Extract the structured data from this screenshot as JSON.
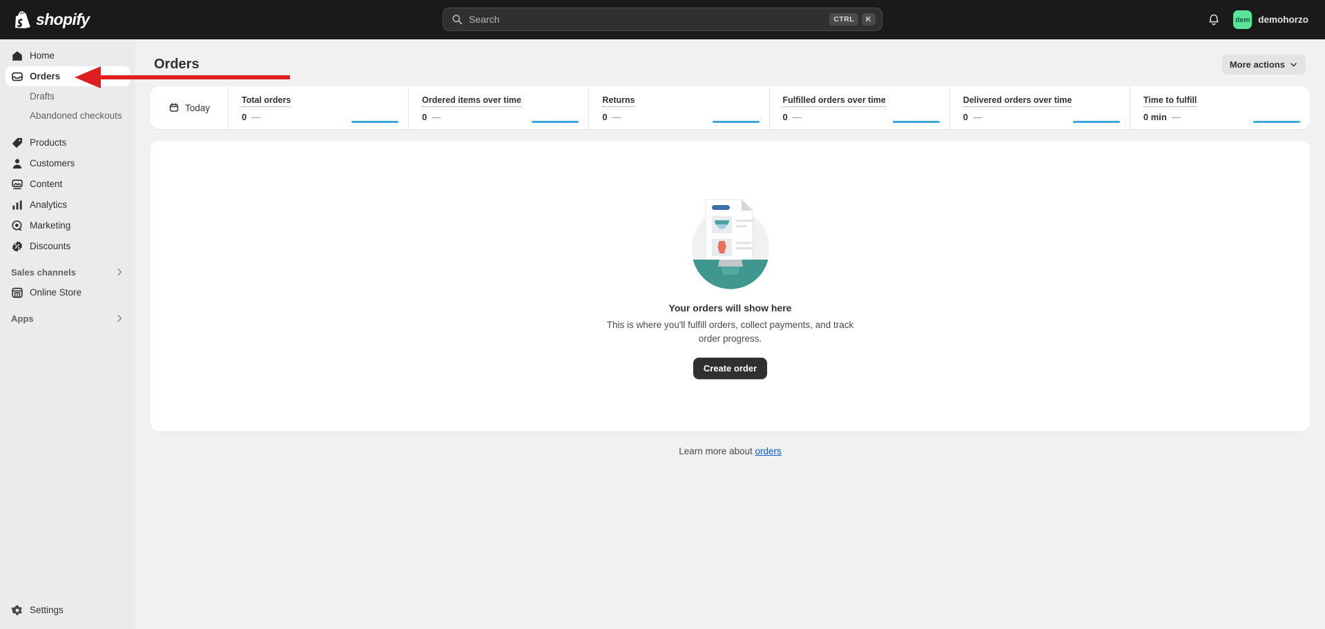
{
  "topbar": {
    "logo_text": "shopify",
    "logo_icon": "shopify-bag-icon",
    "search": {
      "placeholder": "Search",
      "value": "",
      "icon": "search-icon",
      "kbd_ctrl": "CTRL",
      "kbd_key": "K"
    },
    "notifications_icon": "bell-icon",
    "user": {
      "avatar_initials": "dem",
      "avatar_color": "#5be39a",
      "name": "demohorzo"
    }
  },
  "sidebar": {
    "items": [
      {
        "label": "Home",
        "icon": "home-icon",
        "selected": false
      },
      {
        "label": "Orders",
        "icon": "orders-inbox-icon",
        "selected": true
      },
      {
        "label": "Products",
        "icon": "products-tag-icon",
        "selected": false
      },
      {
        "label": "Customers",
        "icon": "customers-person-icon",
        "selected": false
      },
      {
        "label": "Content",
        "icon": "content-image-icon",
        "selected": false
      },
      {
        "label": "Analytics",
        "icon": "analytics-bars-icon",
        "selected": false
      },
      {
        "label": "Marketing",
        "icon": "marketing-target-icon",
        "selected": false
      },
      {
        "label": "Discounts",
        "icon": "discounts-percent-icon",
        "selected": false
      }
    ],
    "orders_subitems": [
      {
        "label": "Drafts"
      },
      {
        "label": "Abandoned checkouts"
      }
    ],
    "sales_channels": {
      "heading": "Sales channels",
      "chevron_icon": "chevron-right-icon",
      "items": [
        {
          "label": "Online Store",
          "icon": "online-store-icon"
        }
      ]
    },
    "apps": {
      "heading": "Apps",
      "chevron_icon": "chevron-right-icon"
    },
    "settings": {
      "label": "Settings",
      "icon": "gear-icon"
    }
  },
  "page": {
    "title": "Orders",
    "more_actions": {
      "label": "More actions",
      "icon": "chevron-down-icon"
    }
  },
  "metrics": {
    "range_chip": {
      "label": "Today",
      "icon": "calendar-icon"
    },
    "sparkline_color": "#3ba5dc",
    "cards": [
      {
        "label": "Total orders",
        "value": "0",
        "change": "—"
      },
      {
        "label": "Ordered items over time",
        "value": "0",
        "change": "—"
      },
      {
        "label": "Returns",
        "value": "0",
        "change": "—"
      },
      {
        "label": "Fulfilled orders over time",
        "value": "0",
        "change": "—"
      },
      {
        "label": "Delivered orders over time",
        "value": "0",
        "change": "—"
      },
      {
        "label": "Time to fulfill",
        "value": "0 min",
        "change": "—"
      }
    ]
  },
  "empty_state": {
    "illustration": "order-receipt-illustration",
    "title": "Your orders will show here",
    "description": "This is where you'll fulfill orders, collect payments, and track order progress.",
    "button_label": "Create order"
  },
  "footer": {
    "learn_more_prefix": "Learn more about ",
    "learn_more_link": "orders"
  },
  "annotation": {
    "type": "arrow",
    "color": "#e02020",
    "points_to": "sidebar-item-orders"
  }
}
